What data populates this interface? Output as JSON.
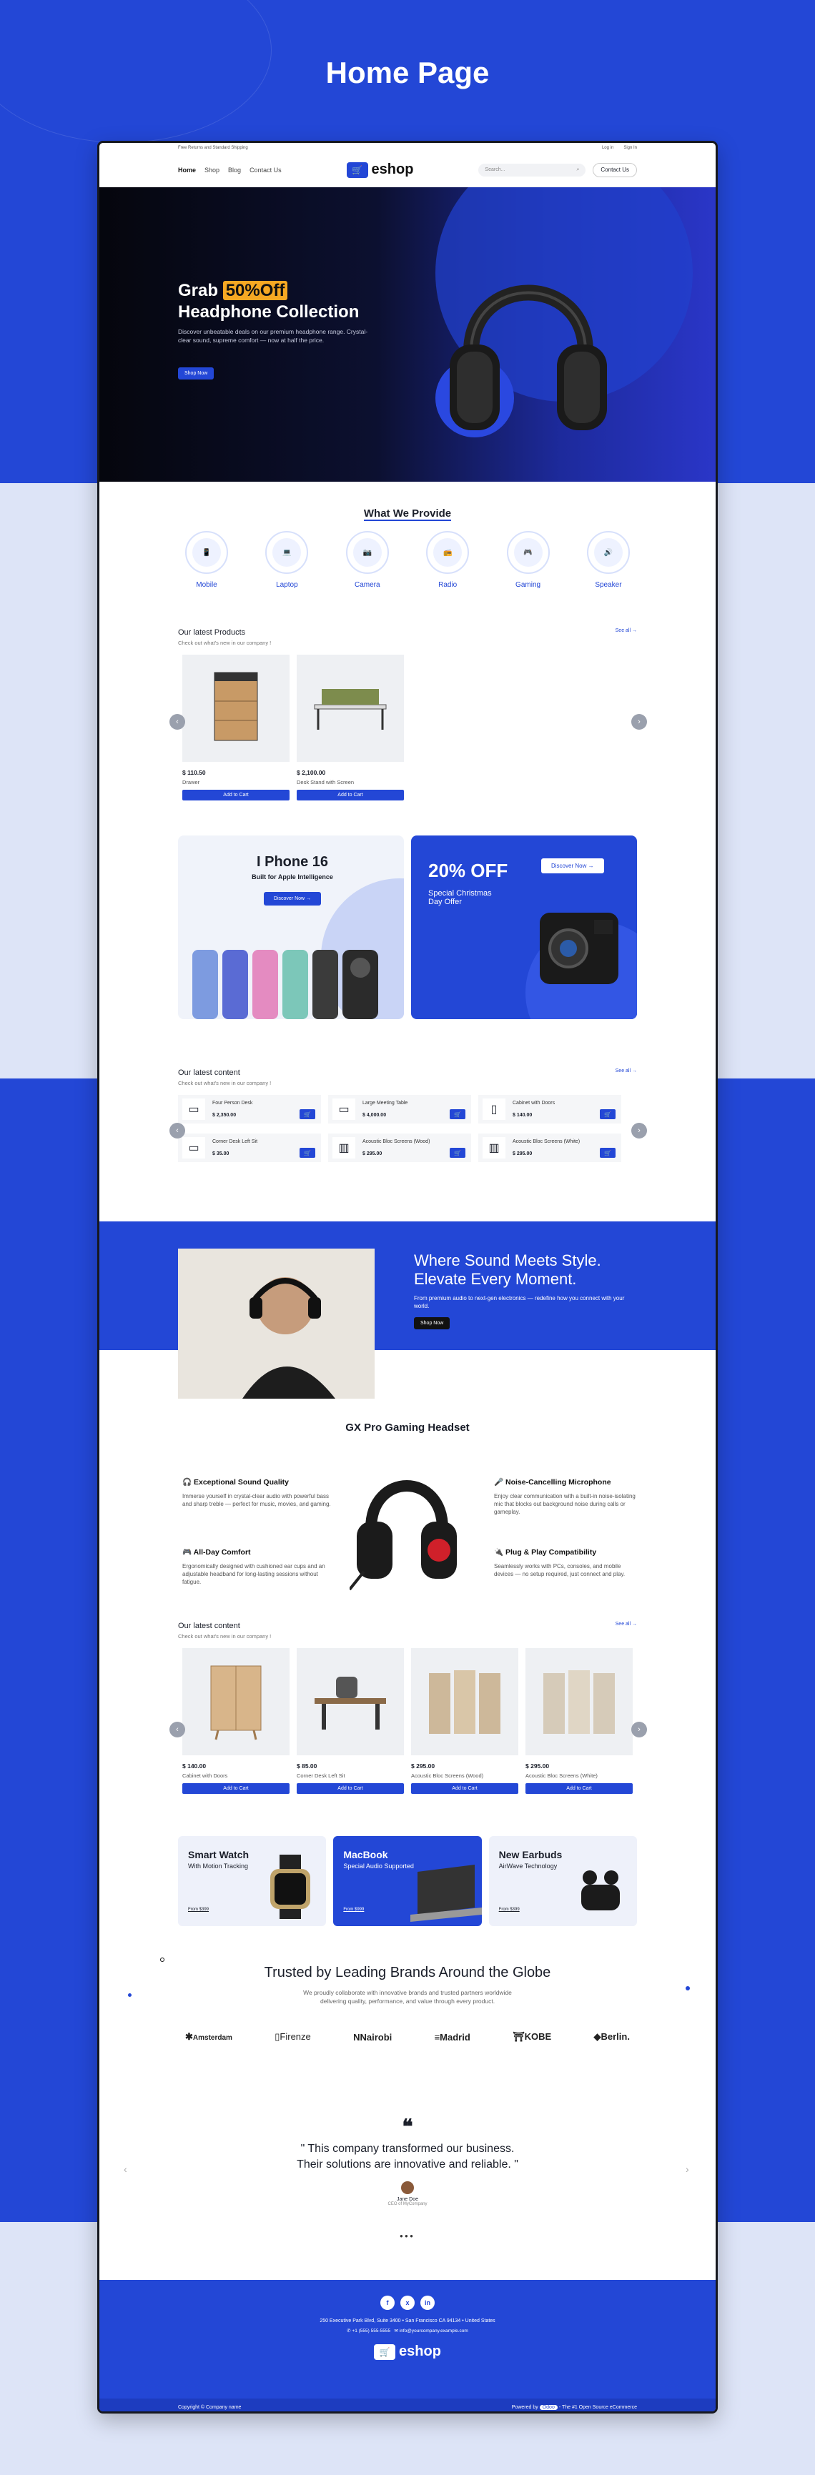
{
  "page_title": "Home Page",
  "topbar": {
    "left": "Free Returns and Standard Shipping",
    "login": "Log in",
    "signup": "Sign In"
  },
  "nav": {
    "links": [
      "Home",
      "Shop",
      "Blog",
      "Contact Us"
    ],
    "logo_text": "eshop",
    "search_placeholder": "Search...",
    "contact_button": "Contact Us"
  },
  "hero": {
    "grab": "Grab",
    "highlight": "50%Off",
    "title": "Headphone Collection",
    "desc": "Discover unbeatable deals on our premium headphone range. Crystal-clear sound, supreme comfort — now at half the price.",
    "button": "Shop Now"
  },
  "categories": {
    "title": "What We Provide",
    "items": [
      "Mobile",
      "Laptop",
      "Camera",
      "Radio",
      "Gaming",
      "Speaker"
    ]
  },
  "latest_products": {
    "title": "Our latest Products",
    "subtitle": "Check out what's new in our company !",
    "see_all": "See all",
    "items": [
      {
        "price": "$ 110.50",
        "name": "Drawer",
        "button": "Add to Cart"
      },
      {
        "price": "$ 2,100.00",
        "name": "Desk Stand with Screen",
        "button": "Add to Cart"
      }
    ]
  },
  "promo": {
    "phone_title": "I Phone 16",
    "phone_sub": "Built for Apple Intelligence",
    "phone_btn": "Discover Now",
    "offer_title": "20% OFF",
    "offer_sub1": "Special Christmas",
    "offer_sub2": "Day Offer",
    "offer_btn": "Discover Now"
  },
  "latest_content1": {
    "title": "Our latest content",
    "subtitle": "Check out what's new in our company !",
    "see_all": "See all",
    "items": [
      {
        "name": "Four Person Desk",
        "price": "$ 2,350.00"
      },
      {
        "name": "Large Meeting Table",
        "price": "$ 4,000.00"
      },
      {
        "name": "Cabinet with Doors",
        "price": "$ 140.00"
      },
      {
        "name": "Corner Desk Left Sit",
        "price": "$ 35.00"
      },
      {
        "name": "Acoustic Bloc Screens (Wood)",
        "price": "$ 295.00"
      },
      {
        "name": "Acoustic Bloc Screens (White)",
        "price": "$ 295.00"
      }
    ]
  },
  "style_band": {
    "title1": "Where Sound Meets Style.",
    "title2": "Elevate Every Moment.",
    "desc": "From premium audio to next-gen electronics — redefine how you connect with your world.",
    "button": "Shop Now"
  },
  "gaming": {
    "title": "GX Pro Gaming Headset",
    "features": [
      {
        "title": "Exceptional Sound Quality",
        "desc": "Immerse yourself in crystal-clear audio with powerful bass and sharp treble — perfect for music, movies, and gaming."
      },
      {
        "title": "All-Day Comfort",
        "desc": "Ergonomically designed with cushioned ear cups and an adjustable headband for long-lasting sessions without fatigue."
      },
      {
        "title": "Noise-Cancelling Microphone",
        "desc": "Enjoy clear communication with a built-in noise-isolating mic that blocks out background noise during calls or gameplay."
      },
      {
        "title": "Plug & Play Compatibility",
        "desc": "Seamlessly works with PCs, consoles, and mobile devices — no setup required, just connect and play."
      }
    ]
  },
  "latest_content2": {
    "title": "Our latest content",
    "subtitle": "Check out what's new in our company !",
    "see_all": "See all",
    "items": [
      {
        "price": "$ 140.00",
        "name": "Cabinet with Doors",
        "button": "Add to Cart"
      },
      {
        "price": "$ 85.00",
        "name": "Corner Desk Left Sit",
        "button": "Add to Cart"
      },
      {
        "price": "$ 295.00",
        "name": "Acoustic Bloc Screens (Wood)",
        "button": "Add to Cart"
      },
      {
        "price": "$ 295.00",
        "name": "Acoustic Bloc Screens (White)",
        "button": "Add to Cart"
      }
    ]
  },
  "small_promos": [
    {
      "title": "Smart Watch",
      "sub": "With Motion Tracking",
      "from": "From $399"
    },
    {
      "title": "MacBook",
      "sub": "Special Audio Supported",
      "from": "From $999"
    },
    {
      "title": "New Earbuds",
      "sub": "AirWave Technology",
      "from": "From $399"
    }
  ],
  "brands": {
    "title": "Trusted by Leading Brands Around the Globe",
    "desc": "We proudly collaborate with innovative brands and trusted partners worldwide delivering quality, performance, and value through every product.",
    "items": [
      "Amsterdam",
      "Firenze",
      "Nairobi",
      "Madrid",
      "KOBE",
      "Berlin."
    ]
  },
  "testimonial": {
    "quote_line1": "\" This company transformed our business.",
    "quote_line2": "Their solutions are innovative and reliable. \"",
    "name": "Jane Doe",
    "role": "CEO of MyCompany"
  },
  "footer": {
    "social": [
      "f",
      "x",
      "in"
    ],
    "address": "250 Executive Park Blvd, Suite 3400 • San Francisco CA 94134 • United States",
    "phone": "+1 (555) 555-5555",
    "email": "info@yourcompany.example.com",
    "logo_text": "eshop",
    "copyright": "Copyright © Company name",
    "powered": "Powered by",
    "powered_brand": "Odoo",
    "powered_tail": "- The #1 Open Source eCommerce"
  },
  "colors": {
    "primary": "#2347d6",
    "accent": "#f6a823",
    "dark": "#05060d"
  }
}
